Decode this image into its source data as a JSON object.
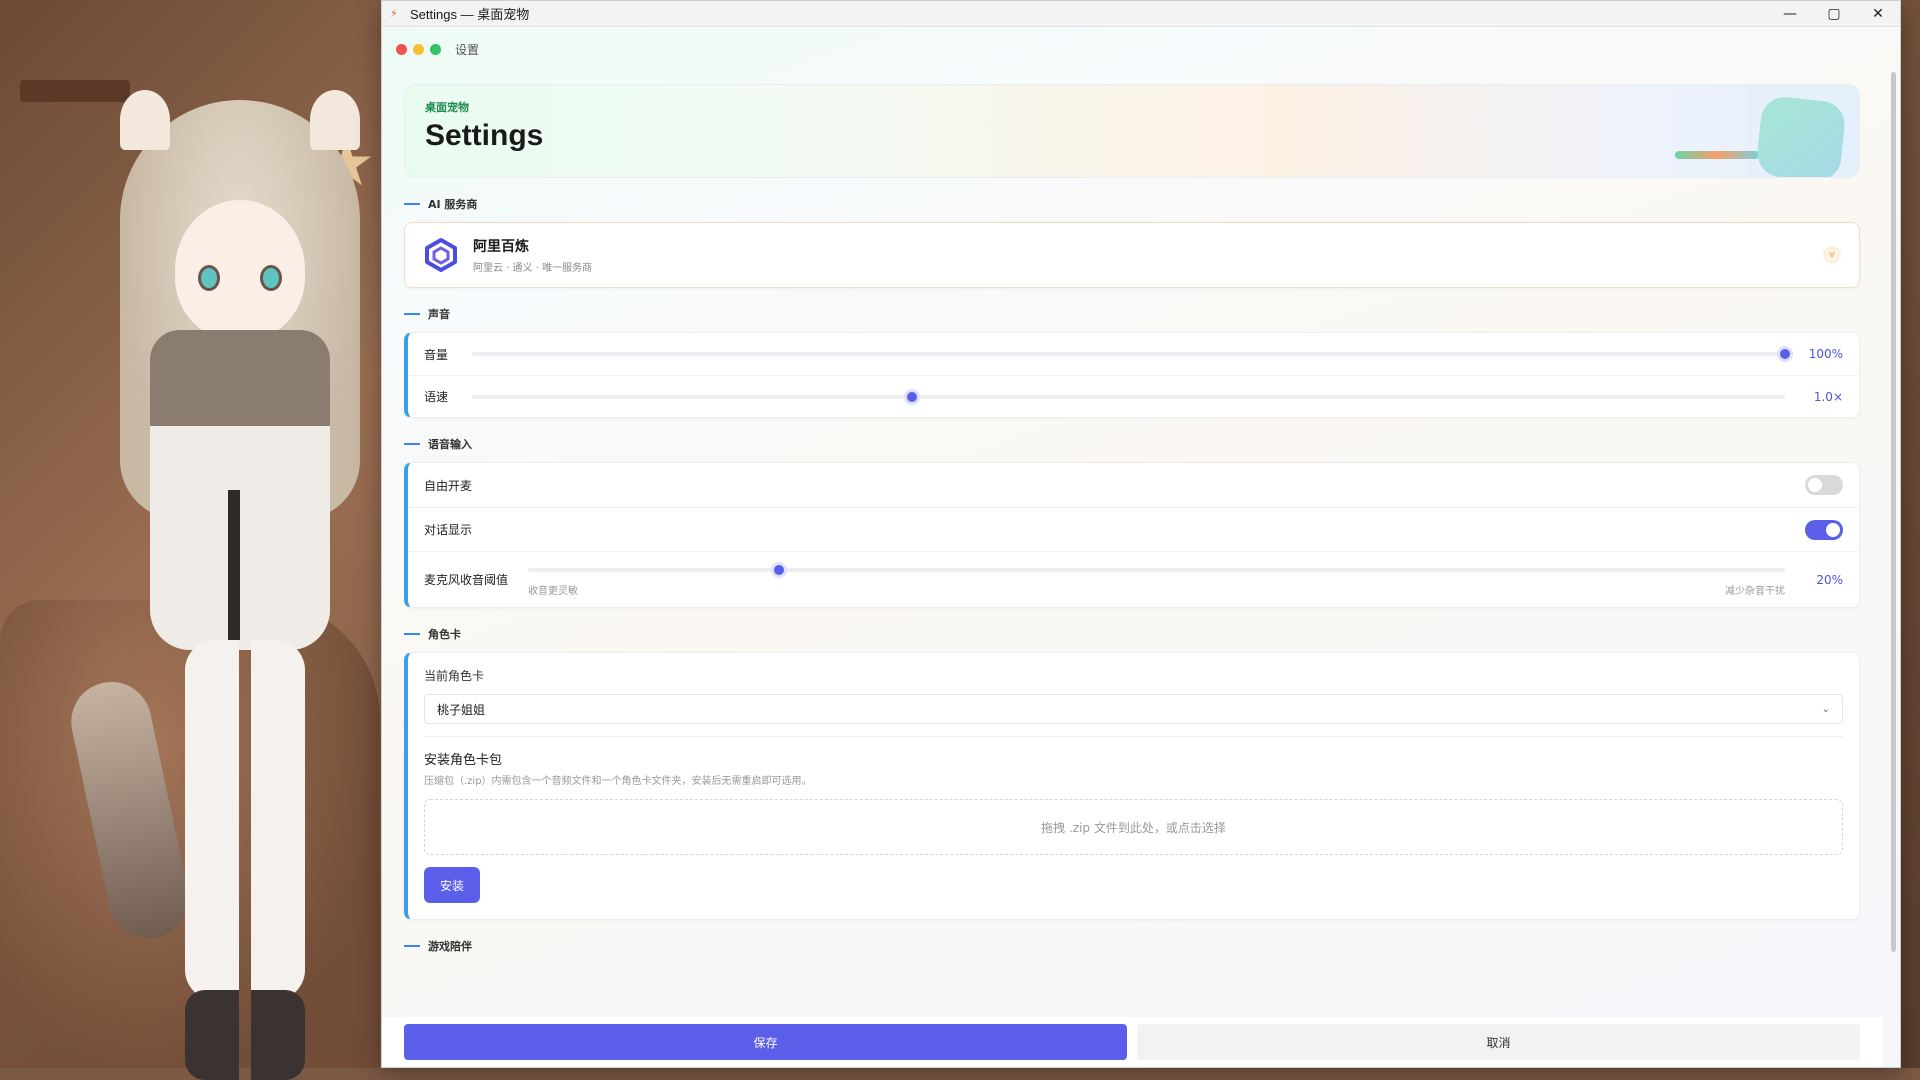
{
  "window": {
    "title": "Settings — 桌面宠物",
    "app_icon": "app-icon",
    "controls": {
      "minimize": "—",
      "maximize": "▢",
      "close": "✕"
    }
  },
  "topbar": {
    "title": "设置",
    "dot_colors": [
      "#ef5350",
      "#f6c035",
      "#34c26a"
    ]
  },
  "hero": {
    "eyebrow": "桌面宠物",
    "title": "Settings"
  },
  "sections": {
    "ai": "AI 服务商",
    "voice": "声音",
    "voice_input": "语音输入",
    "character": "角色卡",
    "game": "游戏陪伴"
  },
  "provider": {
    "name": "阿里百炼",
    "subtitle": "阿里云 · 通义 · 唯一服务商",
    "chevron": "v"
  },
  "voice": {
    "volume_label": "音量",
    "volume_value": "100%",
    "volume_level": 1.0,
    "speed_label": "语速",
    "speed_value": "1.0×",
    "speed_level": 0.335
  },
  "voice_input": {
    "free_mic_label": "自由开麦",
    "free_mic_on": false,
    "show_dialog_label": "对话显示",
    "show_dialog_on": true,
    "threshold_label": "麦克风收音阈值",
    "threshold_left_hint": "收音更灵敏",
    "threshold_right_hint": "减少杂音干扰",
    "threshold_value": "20%",
    "threshold_level": 0.2
  },
  "character": {
    "current_label": "当前角色卡",
    "current_value": "桃子姐姐",
    "caret": "⌄",
    "install_title": "安装角色卡包",
    "install_desc": "压缩包（.zip）内需包含一个音频文件和一个角色卡文件夹，安装后无需重启即可选用。",
    "dropzone": "拖拽 .zip 文件到此处，或点击选择",
    "install_button": "安装"
  },
  "footer": {
    "save": "保存",
    "cancel": "取消"
  },
  "colors": {
    "accent": "#5b5ee8",
    "section_dash": "#3b82f6",
    "card_accent": "#3b9ee6"
  }
}
